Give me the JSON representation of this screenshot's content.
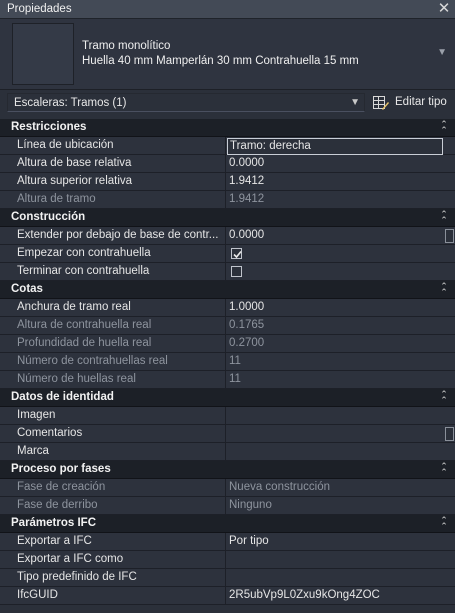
{
  "window": {
    "title": "Propiedades"
  },
  "type_selector": {
    "name": "Tramo monolítico",
    "description": "Huella 40 mm Mamperlán 30 mm Contrahuella 15 mm"
  },
  "filter": {
    "label": "Escaleras: Tramos (1)",
    "edit_type_label": "Editar tipo"
  },
  "groups": {
    "restricciones": {
      "label": "Restricciones",
      "rows": [
        {
          "name": "Línea de ubicación",
          "value": "Tramo: derecha"
        },
        {
          "name": "Altura de base relativa",
          "value": "0.0000"
        },
        {
          "name": "Altura superior relativa",
          "value": "1.9412"
        },
        {
          "name": "Altura de tramo",
          "value": "1.9412"
        }
      ]
    },
    "construccion": {
      "label": "Construcción",
      "rows": [
        {
          "name": "Extender por debajo de base de contr...",
          "value": "0.0000"
        },
        {
          "name": "Empezar con contrahuella",
          "checked": true
        },
        {
          "name": "Terminar con contrahuella",
          "checked": false
        }
      ]
    },
    "cotas": {
      "label": "Cotas",
      "rows": [
        {
          "name": "Anchura de tramo real",
          "value": "1.0000"
        },
        {
          "name": "Altura de contrahuella real",
          "value": "0.1765"
        },
        {
          "name": "Profundidad de huella real",
          "value": "0.2700"
        },
        {
          "name": "Número de contrahuellas real",
          "value": "11"
        },
        {
          "name": "Número de huellas real",
          "value": "11"
        }
      ]
    },
    "identidad": {
      "label": "Datos de identidad",
      "rows": [
        {
          "name": "Imagen",
          "value": ""
        },
        {
          "name": "Comentarios",
          "value": ""
        },
        {
          "name": "Marca",
          "value": ""
        }
      ]
    },
    "fases": {
      "label": "Proceso por fases",
      "rows": [
        {
          "name": "Fase de creación",
          "value": "Nueva construcción"
        },
        {
          "name": "Fase de derribo",
          "value": "Ninguno"
        }
      ]
    },
    "ifc": {
      "label": "Parámetros IFC",
      "rows": [
        {
          "name": "Exportar a IFC",
          "value": "Por tipo"
        },
        {
          "name": "Exportar a IFC como",
          "value": ""
        },
        {
          "name": "Tipo predefinido de IFC",
          "value": ""
        },
        {
          "name": "IfcGUID",
          "value": "2R5ubVp9L0Zxu9kOng4ZOC"
        }
      ]
    }
  }
}
